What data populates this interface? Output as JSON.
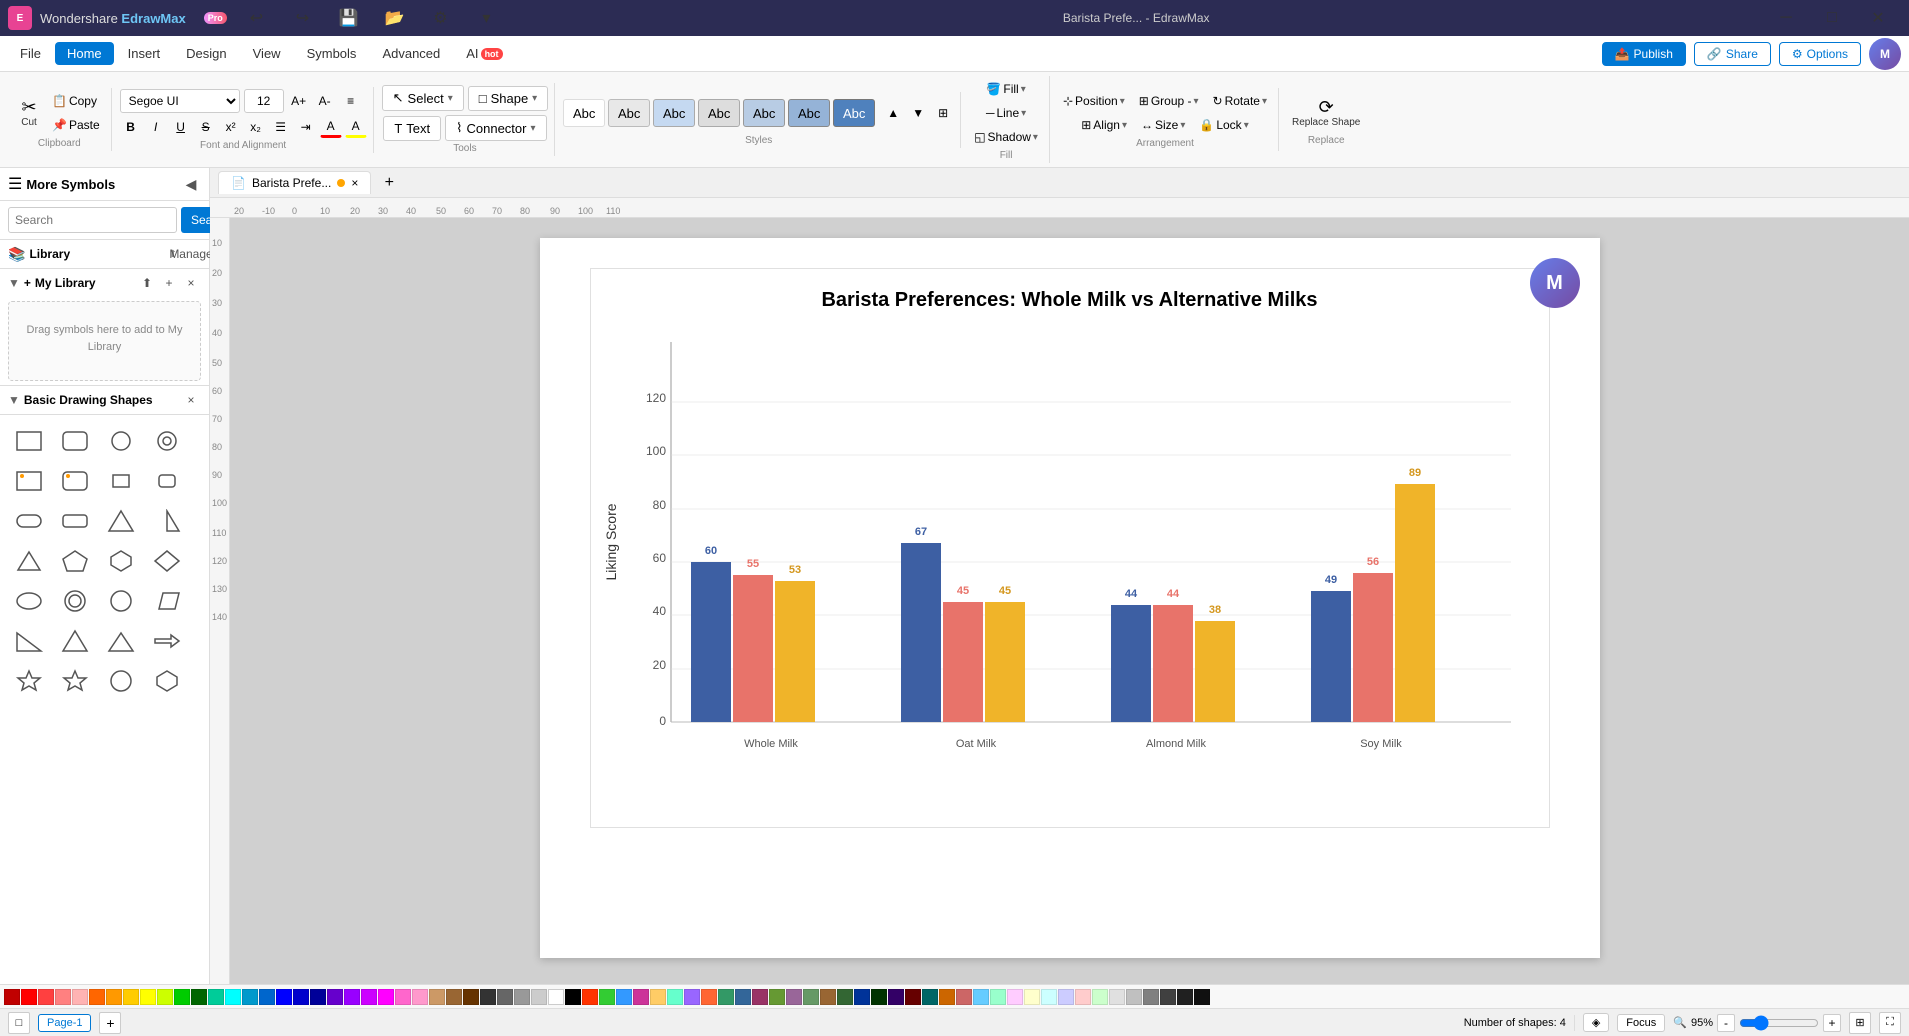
{
  "app": {
    "name": "Wondershare EdrawMax",
    "tier": "Pro",
    "title": "Barista Prefe... - EdrawMax"
  },
  "titlebar": {
    "undo": "↩",
    "redo": "↪",
    "save": "💾",
    "open": "📂",
    "quick_access": "⚙",
    "more": "▾"
  },
  "menubar": {
    "items": [
      "File",
      "Home",
      "Insert",
      "Design",
      "View",
      "Symbols",
      "Advanced",
      "AI"
    ],
    "active": "Home",
    "publish": "Publish",
    "share": "Share",
    "options": "Options"
  },
  "ribbon": {
    "clipboard": {
      "label": "Clipboard",
      "cut": "✂",
      "copy": "📋",
      "paste": "📋",
      "format_painter": "🖌"
    },
    "font": {
      "label": "Font and Alignment",
      "family": "Segoe UI",
      "size": "12",
      "increase": "A+",
      "decrease": "A-",
      "align": "≡",
      "bold": "B",
      "italic": "I",
      "underline": "U",
      "strikethrough": "S",
      "superscript": "x²",
      "subscript": "x₂",
      "textcolor": "A",
      "bgcolor": "A"
    },
    "tools": {
      "label": "Tools",
      "select": "Select",
      "select_arrow": "▾",
      "shape": "Shape",
      "shape_arrow": "▾",
      "text": "Text",
      "connector": "Connector",
      "connector_arrow": "▾"
    },
    "styles": {
      "label": "Styles",
      "items": [
        "Abc",
        "Abc",
        "Abc",
        "Abc",
        "Abc",
        "Abc",
        "Abc"
      ]
    },
    "fill": {
      "label": "Fill",
      "fill": "Fill",
      "line": "Line",
      "shadow": "Shadow"
    },
    "arrangement": {
      "label": "Arrangement",
      "position": "Position",
      "group": "Group -",
      "rotate": "Rotate",
      "align": "Align",
      "size": "Size",
      "lock": "Lock"
    },
    "replace": {
      "label": "Replace",
      "replace_shape": "Replace Shape"
    }
  },
  "sidebar": {
    "title": "More Symbols",
    "collapse_icon": "◀",
    "search_placeholder": "Search",
    "search_btn": "Search",
    "library": {
      "title": "Library",
      "manage": "Manage"
    },
    "my_library": {
      "title": "My Library",
      "drag_text": "Drag symbols here to add to My Library"
    },
    "basic_shapes": {
      "title": "Basic Drawing Shapes",
      "close": "×"
    }
  },
  "canvas": {
    "tab": "Barista Prefe...",
    "tab_modified": true,
    "chart_title": "Barista Preferences: Whole Milk vs Alternative Milks",
    "y_axis_label": "Liking Score",
    "y_max": 120,
    "y_ticks": [
      0,
      20,
      40,
      60,
      80,
      100,
      120
    ],
    "groups": [
      {
        "label": "Whole Milk",
        "bars": [
          {
            "color": "#3d5fa3",
            "value": 60
          },
          {
            "color": "#e8736a",
            "value": 55
          },
          {
            "color": "#f0b429",
            "value": 53
          }
        ]
      },
      {
        "label": "Oat Milk",
        "bars": [
          {
            "color": "#3d5fa3",
            "value": 67
          },
          {
            "color": "#e8736a",
            "value": 45
          },
          {
            "color": "#f0b429",
            "value": 45
          }
        ]
      },
      {
        "label": "Almond Milk",
        "bars": [
          {
            "color": "#3d5fa3",
            "value": 44
          },
          {
            "color": "#e8736a",
            "value": 44
          },
          {
            "color": "#f0b429",
            "value": 38
          }
        ]
      },
      {
        "label": "Soy Milk",
        "bars": [
          {
            "color": "#3d5fa3",
            "value": 49
          },
          {
            "color": "#e8736a",
            "value": 56
          },
          {
            "color": "#f0b429",
            "value": 89
          }
        ]
      }
    ]
  },
  "bottombar": {
    "page_label": "Page-1",
    "add_page": "+",
    "shapes_count": "Number of shapes: 4",
    "focus": "Focus",
    "zoom": "95%",
    "zoom_out": "-",
    "zoom_in": "+"
  },
  "colors": {
    "primary": "#0078d4",
    "active_tab": "#0078d4",
    "bar_blue": "#3d5fa3",
    "bar_pink": "#e8736a",
    "bar_yellow": "#f0b429"
  }
}
